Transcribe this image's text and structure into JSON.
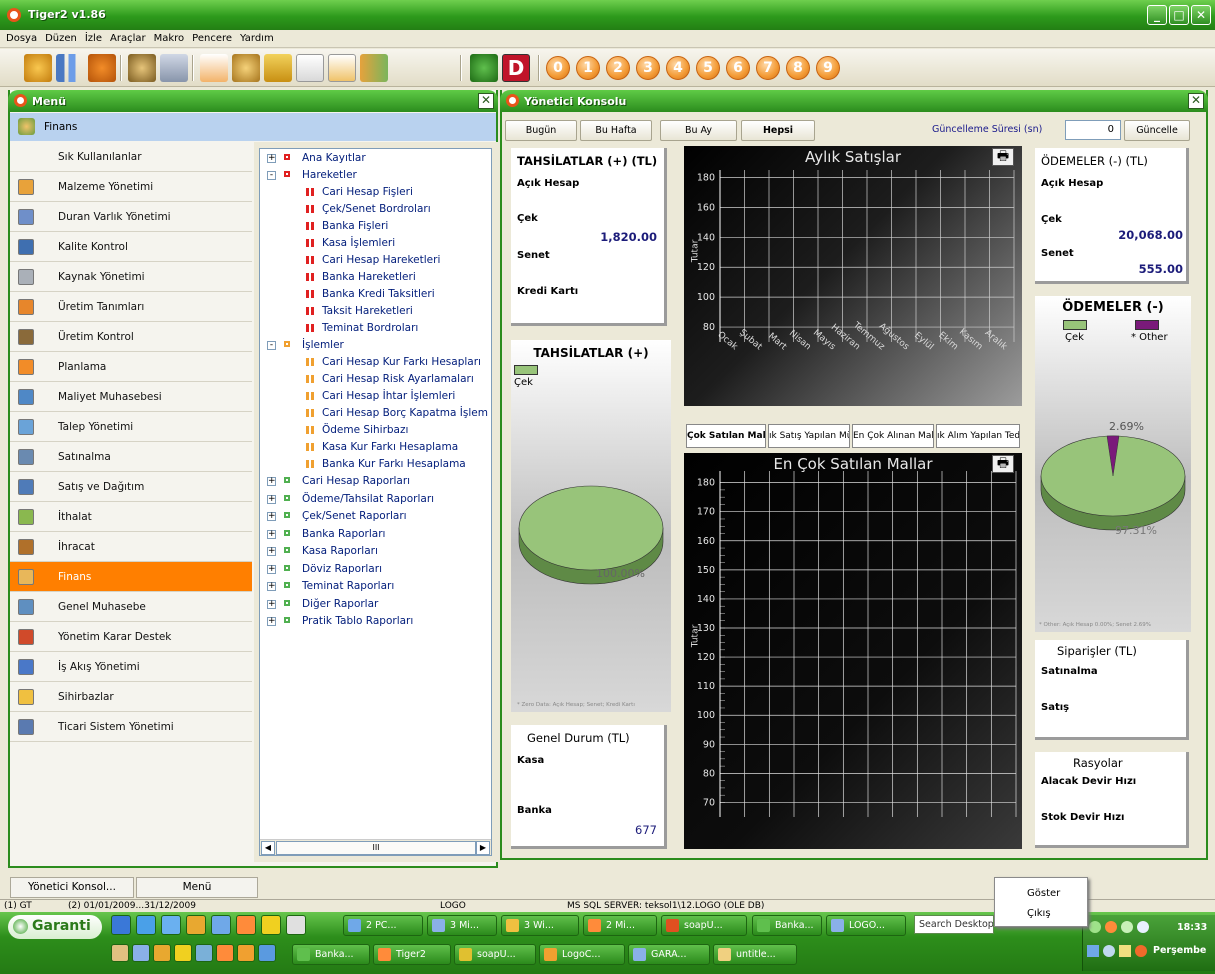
{
  "app": {
    "title": "Tiger2 v1.86"
  },
  "menubar": [
    "Dosya",
    "Düzen",
    "İzle",
    "Araçlar",
    "Makro",
    "Pencere",
    "Yardım"
  ],
  "toolbar": {
    "numbers": [
      "0",
      "1",
      "2",
      "3",
      "4",
      "5",
      "6",
      "7",
      "8",
      "9"
    ],
    "d_label": "D"
  },
  "menu_panel": {
    "title": "Menü",
    "header": "Finans",
    "items": [
      "Sık Kullanılanlar",
      "Malzeme Yönetimi",
      "Duran Varlık Yönetimi",
      "Kalite Kontrol",
      "Kaynak Yönetimi",
      "Üretim Tanımları",
      "Üretim Kontrol",
      "Planlama",
      "Maliyet Muhasebesi",
      "Talep Yönetimi",
      "Satınalma",
      "Satış ve Dağıtım",
      "İthalat",
      "İhracat",
      "Finans",
      "Genel Muhasebe",
      "Yönetim Karar Destek",
      "İş Akış Yönetimi",
      "Sihirbazlar",
      "Ticari Sistem Yönetimi"
    ],
    "active_item": "Finans",
    "tree": {
      "ana": "Ana Kayıtlar",
      "hareketler": "Hareketler",
      "hareket_items": [
        "Cari Hesap Fişleri",
        "Çek/Senet Bordroları",
        "Banka Fişleri",
        "Kasa İşlemleri",
        "Cari Hesap Hareketleri",
        "Banka Hareketleri",
        "Banka Kredi Taksitleri",
        "Taksit Hareketleri",
        "Teminat Bordroları"
      ],
      "islemler": "İşlemler",
      "islem_items": [
        "Cari Hesap Kur Farkı Hesapları",
        "Cari Hesap Risk Ayarlamaları",
        "Cari Hesap İhtar İşlemleri",
        "Cari Hesap Borç Kapatma İşlem",
        "Ödeme Sihirbazı",
        "Kasa Kur Farkı Hesaplama",
        "Banka Kur Farkı Hesaplama"
      ],
      "raporlar": [
        "Cari Hesap Raporları",
        "Ödeme/Tahsilat Raporları",
        "Çek/Senet Raporları",
        "Banka Raporları",
        "Kasa Raporları",
        "Döviz Raporları",
        "Teminat Raporları",
        "Diğer Raporlar",
        "Pratik Tablo Raporları"
      ],
      "scroll_mid": "III"
    }
  },
  "console": {
    "title": "Yönetici Konsolu",
    "period_buttons": [
      "Bugün",
      "Bu Hafta",
      "Bu Ay",
      "Hepsi"
    ],
    "refresh_label": "Güncelleme Süresi (sn)",
    "refresh_value": "0",
    "refresh_button": "Güncelle",
    "tahsilat": {
      "title": "TAHSİLATLAR (+) (TL)",
      "acik": "Açık Hesap",
      "cek": "Çek",
      "cek_val": "1,820.00",
      "senet": "Senet",
      "kredi": "Kredi Kartı"
    },
    "tahsilat_pie": {
      "title": "TAHSİLATLAR (+)",
      "legend": "Çek",
      "pct": "100.00%",
      "footnote": "* Zero Data: Açık Hesap; Senet; Kredi Kartı"
    },
    "genel": {
      "title": "Genel Durum (TL)",
      "kasa": "Kasa",
      "banka": "Banka",
      "banka_val": "677"
    },
    "odemeler": {
      "title": "ÖDEMELER (-) (TL)",
      "acik": "Açık Hesap",
      "cek": "Çek",
      "cek_val": "20,068.00",
      "senet": "Senet",
      "senet_val": "555.00"
    },
    "odeme_pie": {
      "title": "ÖDEMELER (-)",
      "legend": [
        "Çek",
        "* Other"
      ],
      "pct_small": "2.69%",
      "pct_big": "97.31%",
      "footnote": "* Other: Açık Hesap 0.00%; Senet 2.69%"
    },
    "siparisler": {
      "title": "Siparişler (TL)",
      "satinalma": "Satınalma",
      "satis": "Satış"
    },
    "rasyolar": {
      "title": "Rasyolar",
      "alacak": "Alacak Devir Hızı",
      "stok": "Stok Devir Hızı"
    },
    "tab_buttons": [
      "Çok Satılan Mall",
      "ık Satış Yapılan Müş",
      "En Çok Alınan Malla",
      "ık Alım Yapılan Teda"
    ]
  },
  "chart_data": [
    {
      "type": "bar",
      "title": "Aylık Satışlar",
      "ylabel": "Tutar",
      "categories": [
        "Ocak",
        "Şubat",
        "Mart",
        "Nisan",
        "Mayıs",
        "Haziran",
        "Temmuz",
        "Ağustos",
        "Eylül",
        "Ekim",
        "Kasım",
        "Aralık"
      ],
      "values": [],
      "yticks": [
        80,
        100,
        120,
        140,
        160,
        180
      ]
    },
    {
      "type": "bar",
      "title": "En Çok Satılan Mallar",
      "ylabel": "Tutar",
      "categories": [],
      "values": [],
      "yticks": [
        70,
        80,
        90,
        100,
        110,
        120,
        130,
        140,
        150,
        160,
        170,
        180
      ]
    },
    {
      "type": "pie",
      "title": "TAHSİLATLAR (+)",
      "labels": [
        "Çek"
      ],
      "values": [
        100.0
      ]
    },
    {
      "type": "pie",
      "title": "ÖDEMELER (-)",
      "labels": [
        "Çek",
        "* Other"
      ],
      "values": [
        97.31,
        2.69
      ]
    }
  ],
  "bottom_tabs": [
    "Yönetici Konsol...",
    "Menü"
  ],
  "status": {
    "s1": "(1) GT",
    "s2": "(2) 01/01/2009...31/12/2009",
    "s3": "LOGO",
    "s4": "MS SQL SERVER: teksol1\\12.LOGO (OLE DB)"
  },
  "popup": {
    "show": "Göster",
    "exit": "Çıkış"
  },
  "taskbar": {
    "start": "Garanti",
    "row1": [
      "2 PC...",
      "3 Mi...",
      "3 Wi...",
      "2 Mi...",
      "soapU...",
      "Banka...",
      "LOGO..."
    ],
    "row2": [
      "Banka...",
      "Tiger2",
      "soapU...",
      "LogoC...",
      "GARA...",
      "untitle..."
    ],
    "search": "Search Desktop",
    "time": "18:33",
    "day": "Perşembe"
  },
  "colors": {
    "accent_green": "#2d9a1c",
    "active_orange": "#ff7f00",
    "pie_green": "#98c47a",
    "pie_purple": "#7a1a7a"
  }
}
